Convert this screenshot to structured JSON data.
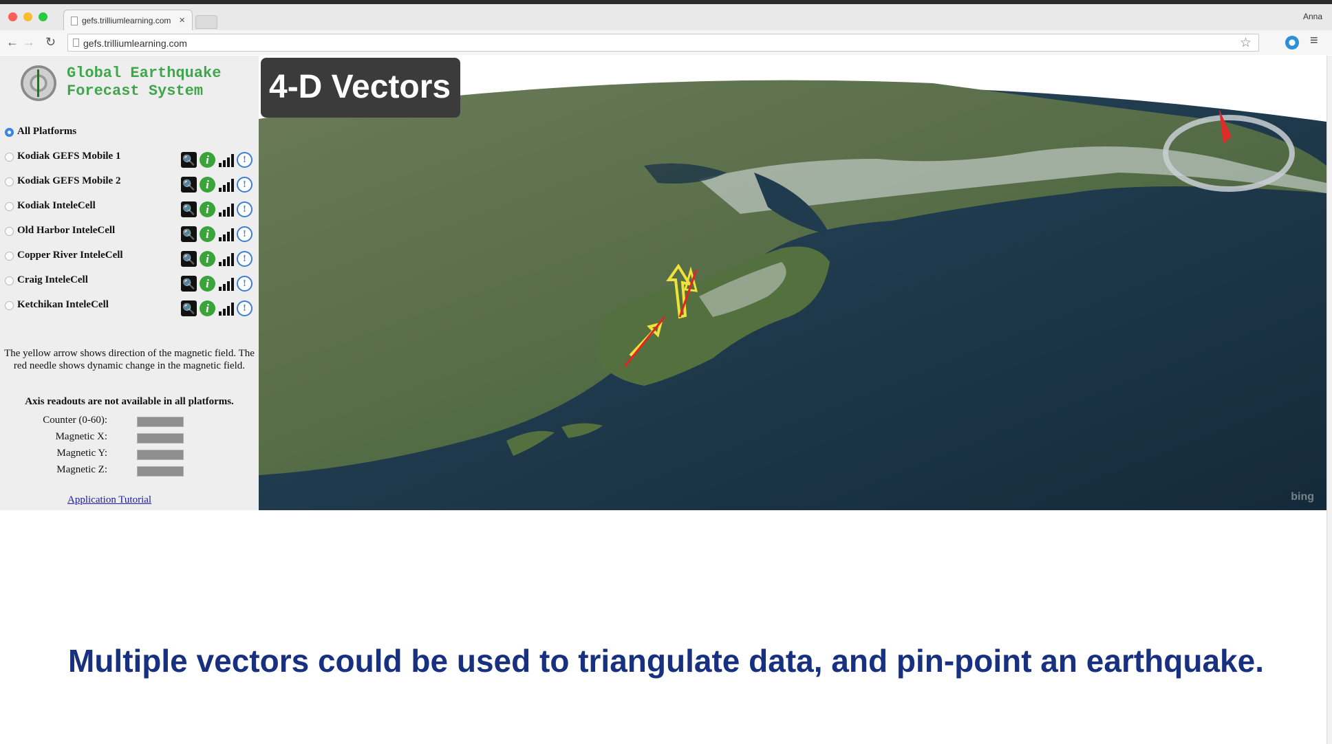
{
  "browser": {
    "tab_title": "gefs.trilliumlearning.com",
    "tab_close": "×",
    "url": "gefs.trilliumlearning.com",
    "user": "Anna",
    "back": "←",
    "forward": "→",
    "reload": "↻",
    "star": "☆",
    "menu": "≡"
  },
  "app": {
    "title": "Global Earthquake\nForecast System",
    "platforms": [
      {
        "label": "All Platforms",
        "selected": true,
        "tools": false
      },
      {
        "label": "Kodiak GEFS Mobile 1",
        "selected": false,
        "tools": true
      },
      {
        "label": "Kodiak GEFS Mobile 2",
        "selected": false,
        "tools": true
      },
      {
        "label": "Kodiak InteleCell",
        "selected": false,
        "tools": true
      },
      {
        "label": "Old Harbor InteleCell",
        "selected": false,
        "tools": true
      },
      {
        "label": "Copper River InteleCell",
        "selected": false,
        "tools": true
      },
      {
        "label": "Craig InteleCell",
        "selected": false,
        "tools": true
      },
      {
        "label": "Ketchikan InteleCell",
        "selected": false,
        "tools": true
      }
    ],
    "tool_icons": {
      "zoom": "zoom-icon",
      "info": "info-icon",
      "signal": "signal-bars-icon",
      "details": "details-icon",
      "zoom_glyph": "🔍",
      "info_glyph": "i",
      "details_glyph": "!"
    },
    "help_text": "The yellow arrow shows direction of the magnetic field. The red needle shows dynamic change in the magnetic field.",
    "axis_note": "Axis readouts are not available in all platforms.",
    "readouts": [
      {
        "label": "Counter (0-60):"
      },
      {
        "label": "Magnetic X:"
      },
      {
        "label": "Magnetic Y:"
      },
      {
        "label": "Magnetic Z:"
      }
    ],
    "tutorial_link": "Application Tutorial"
  },
  "map": {
    "overlay_title": "4-D Vectors",
    "attribution": "bing",
    "colors": {
      "ocean": "#1f3a4f",
      "land": "#4a6a3a",
      "snow": "#e6ecef",
      "arrow": "#f0e23a",
      "needle": "#e22424"
    }
  },
  "caption": "Multiple vectors could be used to triangulate data, and pin-point an earthquake."
}
